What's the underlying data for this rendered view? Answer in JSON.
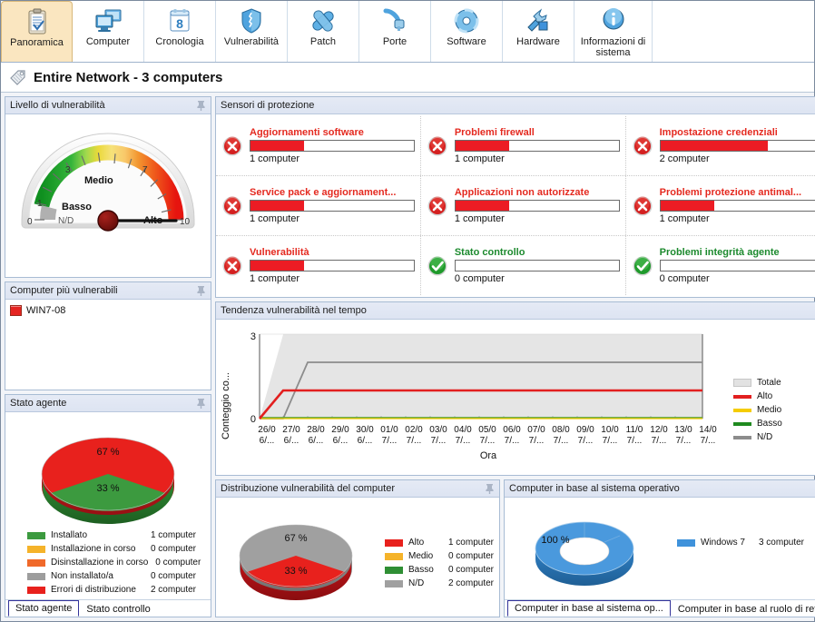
{
  "toolbar": {
    "items": [
      {
        "label": "Panoramica",
        "icon": "clipboard-icon",
        "active": true
      },
      {
        "label": "Computer",
        "icon": "computer-icon",
        "active": false
      },
      {
        "label": "Cronologia",
        "icon": "calendar-icon",
        "active": false
      },
      {
        "label": "Vulnerabilità",
        "icon": "shield-icon",
        "active": false
      },
      {
        "label": "Patch",
        "icon": "bandage-icon",
        "active": false
      },
      {
        "label": "Porte",
        "icon": "plug-icon",
        "active": false
      },
      {
        "label": "Software",
        "icon": "disc-icon",
        "active": false
      },
      {
        "label": "Hardware",
        "icon": "tools-icon",
        "active": false
      },
      {
        "label": "Informazioni di sistema",
        "icon": "info-icon",
        "active": false
      }
    ]
  },
  "header": {
    "title": "Entire Network - 3 computers",
    "icon": "tag-icon"
  },
  "panels": {
    "vuln_level": {
      "title": "Livello di vulnerabilità",
      "pin": "pin-icon"
    },
    "most_vulnerable": {
      "title": "Computer più vulnerabili",
      "pin": "pin-icon"
    },
    "agent_state": {
      "title": "Stato agente",
      "pin": "pin-icon"
    },
    "sensors": {
      "title": "Sensori di protezione",
      "pin": "pin-icon"
    },
    "trend": {
      "title": "Tendenza vulnerabilità nel tempo",
      "pin": "pin-icon"
    },
    "distribution": {
      "title": "Distribuzione vulnerabilità del computer",
      "pin": "pin-icon"
    },
    "os": {
      "title": "Computer in base al sistema operativo",
      "pin": "pin-icon"
    }
  },
  "gauge": {
    "min_label": "0",
    "max_label": "10",
    "tick_1": "1",
    "tick_3": "3",
    "tick_7": "7",
    "zone_nd": "N/D",
    "zone_low": "Basso",
    "zone_mid": "Medio",
    "zone_high": "Alto",
    "value": 10
  },
  "most_vulnerable": {
    "rows": [
      {
        "name": "WIN7-08",
        "color": "#e52421"
      }
    ]
  },
  "sensors": {
    "items": [
      {
        "title": "Aggiornamenti software",
        "count": "1 computer",
        "status": "error",
        "pct": 33
      },
      {
        "title": "Problemi firewall",
        "count": "1 computer",
        "status": "error",
        "pct": 33
      },
      {
        "title": "Impostazione credenziali",
        "count": "2 computer",
        "status": "error",
        "pct": 66
      },
      {
        "title": "Service pack e aggiornament...",
        "count": "1 computer",
        "status": "error",
        "pct": 33
      },
      {
        "title": "Applicazioni non autorizzate",
        "count": "1 computer",
        "status": "error",
        "pct": 33
      },
      {
        "title": "Problemi protezione antimal...",
        "count": "1 computer",
        "status": "error",
        "pct": 33
      },
      {
        "title": "Vulnerabilità",
        "count": "1 computer",
        "status": "error",
        "pct": 33
      },
      {
        "title": "Stato controllo",
        "count": "0 computer",
        "status": "ok",
        "pct": 0
      },
      {
        "title": "Problemi integrità agente",
        "count": "0 computer",
        "status": "ok",
        "pct": 0
      }
    ]
  },
  "agent_tabs": {
    "items": [
      {
        "label": "Stato agente",
        "selected": true
      },
      {
        "label": "Stato controllo",
        "selected": false
      }
    ]
  },
  "os_tabs": {
    "items": [
      {
        "label": "Computer in base al sistema op...",
        "selected": true
      },
      {
        "label": "Computer in base al ruolo di rete",
        "selected": false
      }
    ]
  },
  "chart_data": [
    {
      "id": "agent-state-pie",
      "type": "pie",
      "title": "Stato agente",
      "labels": [
        "Installato",
        "Installazione in corso",
        "Disinstallazione in corso",
        "Non installato/a",
        "Errori di distribuzione"
      ],
      "values": [
        1,
        0,
        0,
        0,
        2
      ],
      "value_labels": [
        "1 computer",
        "0 computer",
        "0 computer",
        "0 computer",
        "2 computer"
      ],
      "percent_labels": [
        "33 %",
        "67 %"
      ],
      "colors": [
        "#3c9a3f",
        "#f5b32a",
        "#f0692a",
        "#9d9d9d",
        "#e8211d"
      ],
      "legend": "bottom"
    },
    {
      "id": "vuln-trend-line",
      "type": "line",
      "title": "Tendenza vulnerabilità nel tempo",
      "xlabel": "Ora",
      "ylabel": "Conteggio co...",
      "ylim": [
        0,
        3
      ],
      "ytick_labels": [
        "0",
        "3"
      ],
      "grid": false,
      "legend": "right",
      "x": [
        "26/06/...",
        "27/06/...",
        "28/06/...",
        "29/06/...",
        "30/06/...",
        "01/07/...",
        "02/07/...",
        "03/07/...",
        "04/07/...",
        "05/07/...",
        "06/07/...",
        "07/07/...",
        "08/07/...",
        "09/07/...",
        "10/07/...",
        "11/07/...",
        "12/07/...",
        "13/07/...",
        "14/07/..."
      ],
      "x_top_labels": [
        "26/0",
        "27/0",
        "28/0",
        "29/0",
        "30/0",
        "01/0",
        "02/0",
        "03/0",
        "04/0",
        "05/0",
        "06/0",
        "07/0",
        "08/0",
        "09/0",
        "10/0",
        "11/0",
        "12/0",
        "13/0",
        "14/0"
      ],
      "x_bottom_labels": [
        "6/...",
        "6/...",
        "6/...",
        "6/...",
        "6/...",
        "7/...",
        "7/...",
        "7/...",
        "7/...",
        "7/...",
        "7/...",
        "7/...",
        "7/...",
        "7/...",
        "7/...",
        "7/...",
        "7/...",
        "7/...",
        "7/..."
      ],
      "series": [
        {
          "name": "Totale",
          "color": "#d8d8d8",
          "kind": "area",
          "values": [
            0,
            3,
            3,
            3,
            3,
            3,
            3,
            3,
            3,
            3,
            3,
            3,
            3,
            3,
            3,
            3,
            3,
            3,
            3
          ]
        },
        {
          "name": "Alto",
          "color": "#e21f1f",
          "kind": "line",
          "values": [
            0,
            1,
            1,
            1,
            1,
            1,
            1,
            1,
            1,
            1,
            1,
            1,
            1,
            1,
            1,
            1,
            1,
            1,
            1
          ]
        },
        {
          "name": "Medio",
          "color": "#f5cc00",
          "kind": "line",
          "values": [
            0,
            0,
            0,
            0,
            0,
            0,
            0,
            0,
            0,
            0,
            0,
            0,
            0,
            0,
            0,
            0,
            0,
            0,
            0
          ]
        },
        {
          "name": "Basso",
          "color": "#1f8a1f",
          "kind": "line",
          "values": [
            0,
            0,
            0,
            0,
            0,
            0,
            0,
            0,
            0,
            0,
            0,
            0,
            0,
            0,
            0,
            0,
            0,
            0,
            0
          ]
        },
        {
          "name": "N/D",
          "color": "#8c8c8c",
          "kind": "line",
          "values": [
            0,
            0,
            2,
            2,
            2,
            2,
            2,
            2,
            2,
            2,
            2,
            2,
            2,
            2,
            2,
            2,
            2,
            2,
            2
          ]
        }
      ]
    },
    {
      "id": "vuln-distribution-pie",
      "type": "pie",
      "title": "Distribuzione vulnerabilità del computer",
      "labels": [
        "Alto",
        "Medio",
        "Basso",
        "N/D"
      ],
      "values": [
        1,
        0,
        0,
        2
      ],
      "value_labels": [
        "1 computer",
        "0 computer",
        "0 computer",
        "2 computer"
      ],
      "percent_labels": [
        "33 %",
        "67 %"
      ],
      "colors": [
        "#e8211d",
        "#f5b32a",
        "#2f8f34",
        "#a0a0a0"
      ],
      "legend": "right"
    },
    {
      "id": "os-donut",
      "type": "pie",
      "title": "Computer in base al sistema operativo",
      "labels": [
        "Windows 7"
      ],
      "values": [
        3
      ],
      "value_labels": [
        "3 computer"
      ],
      "percent_labels": [
        "100 %"
      ],
      "colors": [
        "#3f92db"
      ],
      "legend": "right",
      "donut": true
    }
  ]
}
